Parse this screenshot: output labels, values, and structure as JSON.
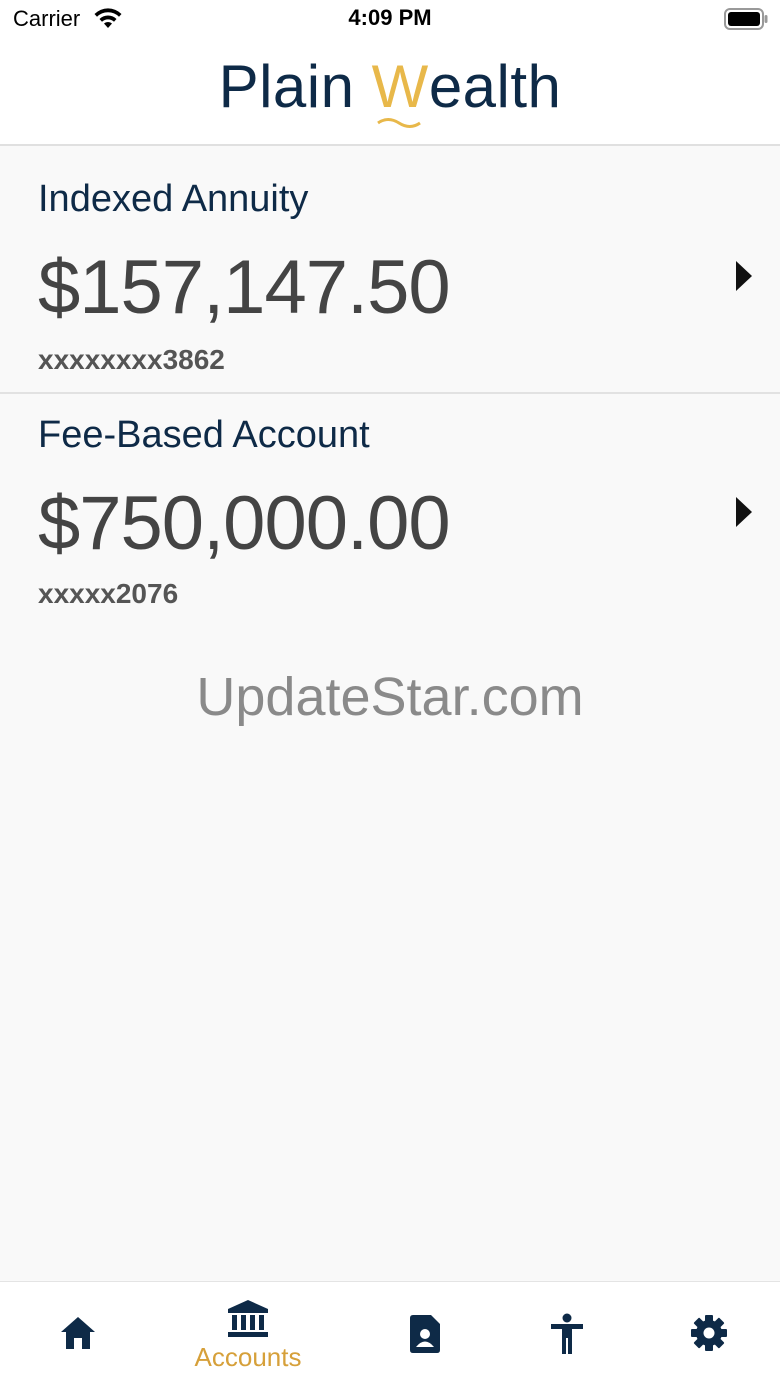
{
  "status_bar": {
    "carrier": "Carrier",
    "time": "4:09 PM"
  },
  "header": {
    "logo_part1": "Plain",
    "logo_w": "W",
    "logo_part2": "ealth"
  },
  "accounts": [
    {
      "name": "Indexed Annuity",
      "balance": "$157,147.50",
      "number": "xxxxxxxx3862"
    },
    {
      "name": "Fee-Based Account",
      "balance": "$750,000.00",
      "number": "xxxxx2076"
    }
  ],
  "watermark": "UpdateStar.com",
  "tabbar": {
    "items": [
      {
        "icon": "home-icon",
        "label": ""
      },
      {
        "icon": "bank-icon",
        "label": "Accounts",
        "active": true
      },
      {
        "icon": "document-icon",
        "label": ""
      },
      {
        "icon": "accessibility-icon",
        "label": ""
      },
      {
        "icon": "gear-icon",
        "label": ""
      }
    ]
  },
  "colors": {
    "navy": "#0e2a47",
    "gold": "#d6a03a",
    "logo_gold": "#e8b84a"
  }
}
